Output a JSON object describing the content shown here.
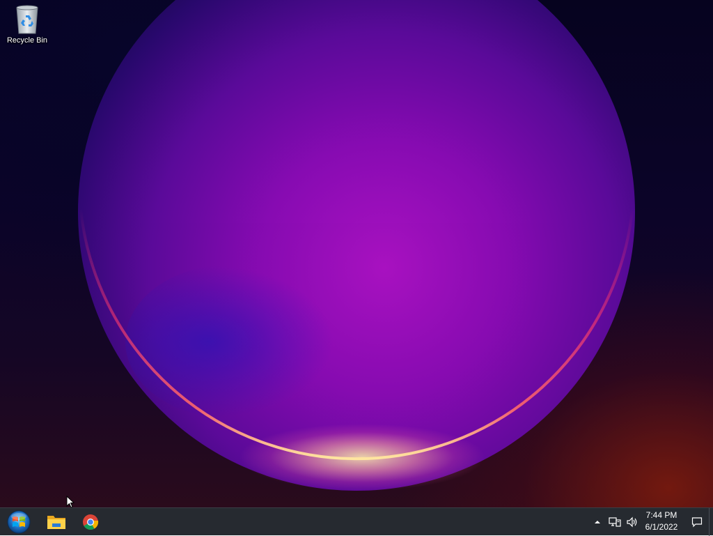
{
  "desktop": {
    "icons": [
      {
        "label": "Recycle Bin",
        "icon": "recycle-bin-icon"
      }
    ]
  },
  "taskbar": {
    "start": {
      "icon": "windows-start-icon"
    },
    "pinned": [
      {
        "name": "File Explorer",
        "icon": "file-explorer-icon"
      },
      {
        "name": "Google Chrome",
        "icon": "chrome-icon"
      }
    ],
    "tray": {
      "overflow_icon": "chevron-up-icon",
      "network_icon": "network-icon",
      "volume_icon": "volume-icon",
      "time": "7:44 PM",
      "date": "6/1/2022",
      "notifications_icon": "action-center-icon"
    }
  }
}
